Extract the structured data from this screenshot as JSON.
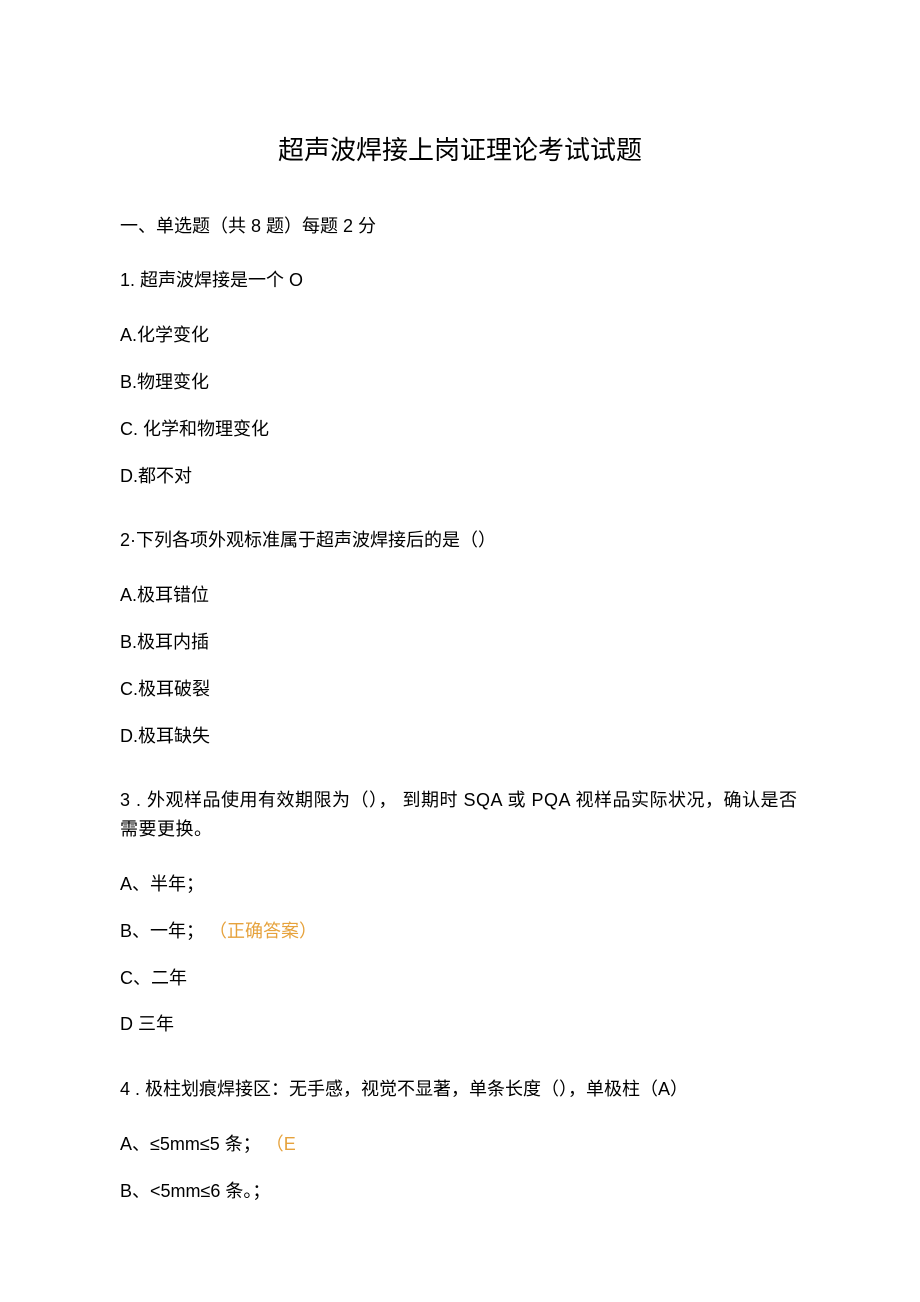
{
  "title": "超声波焊接上岗证理论考试试题",
  "section": "一、单选题（共 8 题）每题 2 分",
  "q1": {
    "text": "1. 超声波焊接是一个 O",
    "a": "A.化学变化",
    "b": "B.物理变化",
    "c": "C. 化学和物理变化",
    "d": "D.都不对"
  },
  "q2": {
    "text": "2·下列各项外观标准属于超声波焊接后的是（）",
    "a": "A.极耳错位",
    "b": "B.极耳内插",
    "c": "C.极耳破裂",
    "d": "D.极耳缺失"
  },
  "q3": {
    "text": "3  . 外观样品使用有效期限为（），  到期时 SQA 或 PQA 视样品实际状况，确认是否需要更换。",
    "a": "A、半年；",
    "b_text": "B、一年；",
    "b_correct": "（正确答案）",
    "c": "C、二年",
    "d": "D 三年"
  },
  "q4": {
    "text": "4  . 极柱划痕焊接区：无手感，视觉不显著，单条长度（），单极柱（A）",
    "a_text": "A、≤5mm≤5 条；",
    "a_mark": "（E",
    "b": "B、<5mm≤6 条。；"
  }
}
